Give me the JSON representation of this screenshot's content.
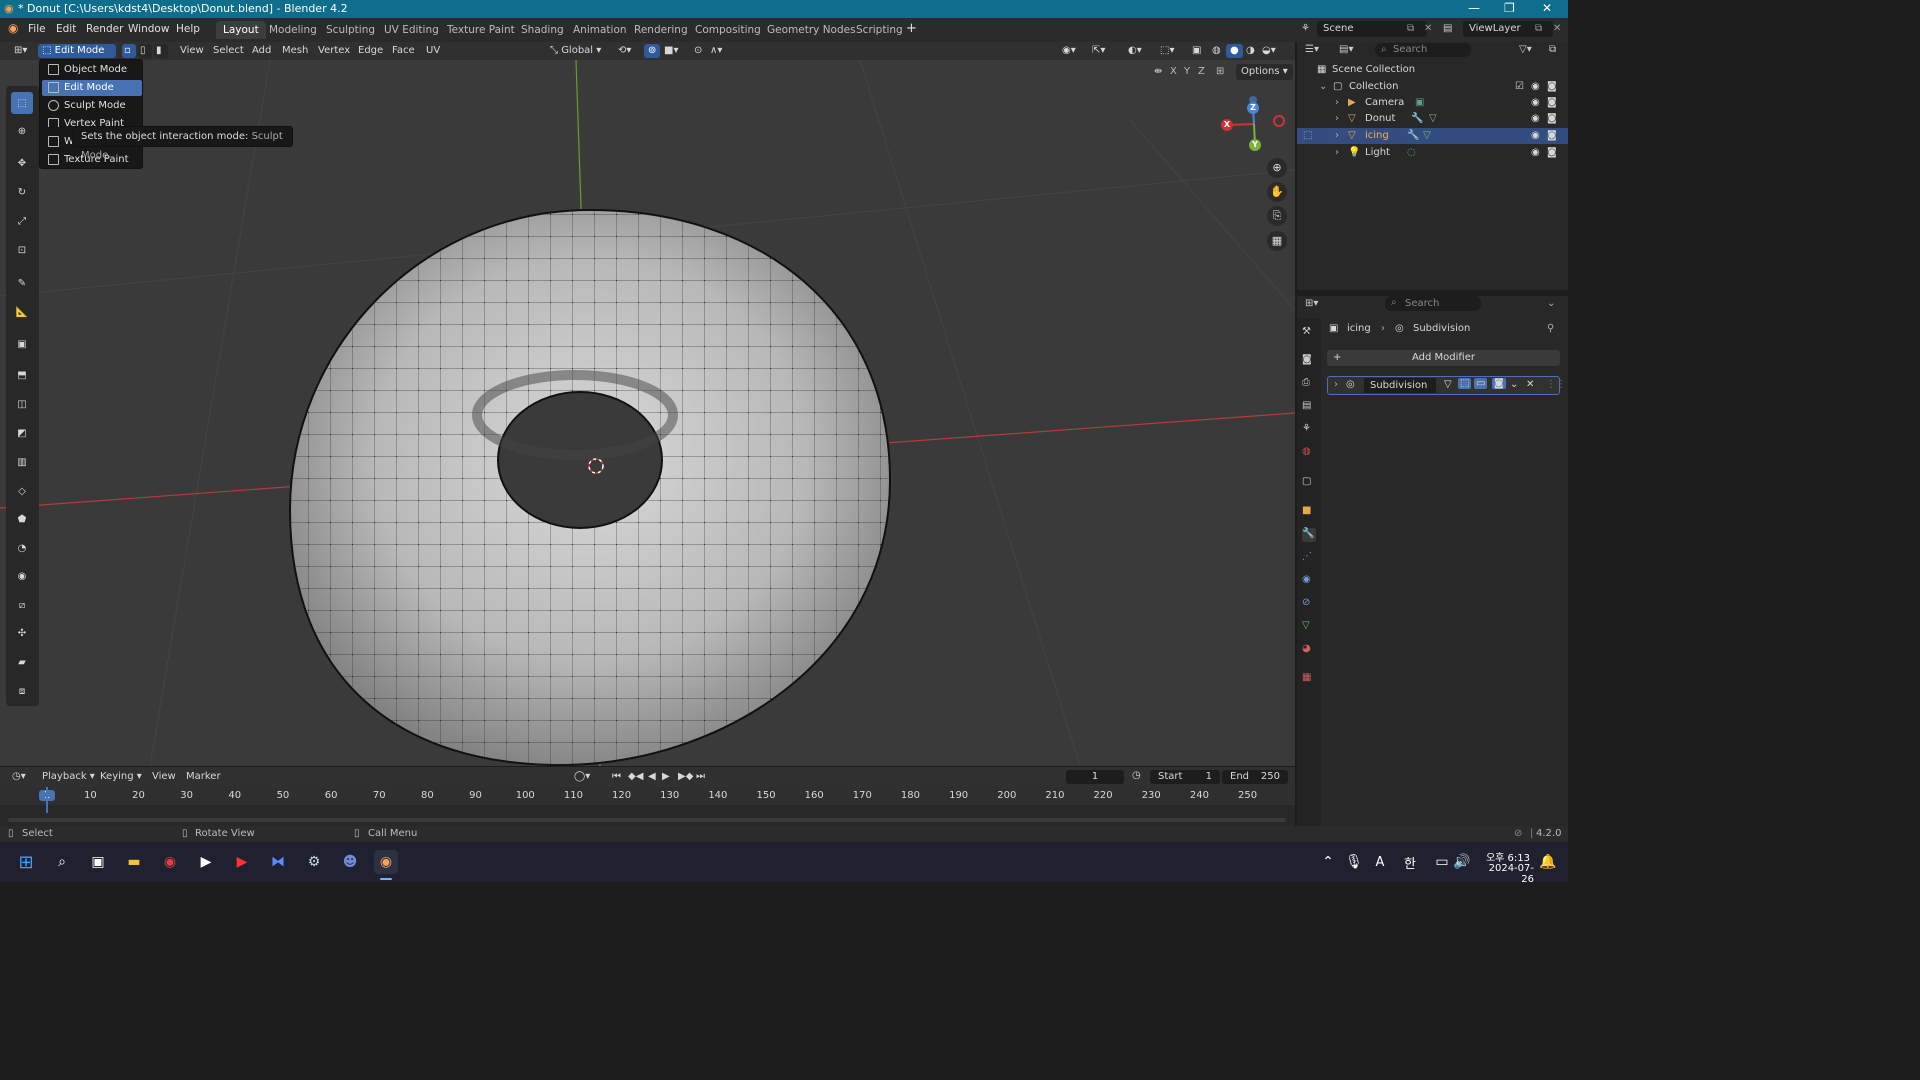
{
  "window": {
    "title": "* Donut [C:\\Users\\kdst4\\Desktop\\Donut.blend] - Blender 4.2"
  },
  "topmenu": [
    "File",
    "Edit",
    "Render",
    "Window",
    "Help"
  ],
  "workspaces": [
    "Layout",
    "Modeling",
    "Sculpting",
    "UV Editing",
    "Texture Paint",
    "Shading",
    "Animation",
    "Rendering",
    "Compositing",
    "Geometry Nodes",
    "Scripting"
  ],
  "scene": {
    "scene_label": "Scene",
    "viewlayer_label": "ViewLayer"
  },
  "viewport_header": {
    "mode": "Edit Mode",
    "menus": [
      "View",
      "Select",
      "Add",
      "Mesh",
      "Vertex",
      "Edge",
      "Face",
      "UV"
    ],
    "orientation": "Global",
    "options": "Options",
    "axes": [
      "X",
      "Y",
      "Z"
    ]
  },
  "mode_menu": {
    "items": [
      "Object Mode",
      "Edit Mode",
      "Sculpt Mode",
      "Vertex Paint",
      "Weight Paint",
      "Texture Paint"
    ],
    "selected": "Edit Mode"
  },
  "tooltip": {
    "text": "Sets the object interaction mode:",
    "value": "Sculpt Mode"
  },
  "gizmo": {
    "x": "X",
    "y": "Y",
    "z": "Z"
  },
  "outliner": {
    "search_placeholder": "Search",
    "scene_collection": "Scene Collection",
    "collection": "Collection",
    "objects": [
      {
        "name": "Camera",
        "selected": false
      },
      {
        "name": "Donut",
        "selected": false
      },
      {
        "name": "icing",
        "selected": true
      },
      {
        "name": "Light",
        "selected": false
      }
    ]
  },
  "properties": {
    "search_placeholder": "Search",
    "breadcrumb_object": "icing",
    "breadcrumb_modifier": "Subdivision",
    "add_modifier": "Add Modifier",
    "modifier_name": "Subdivision"
  },
  "timeline": {
    "menus": [
      "Playback",
      "Keying",
      "View",
      "Marker"
    ],
    "current_frame": "1",
    "start_label": "Start",
    "start_value": "1",
    "end_label": "End",
    "end_value": "250",
    "ticks": [
      "1",
      "10",
      "20",
      "30",
      "40",
      "50",
      "60",
      "70",
      "80",
      "90",
      "100",
      "110",
      "120",
      "130",
      "140",
      "150",
      "160",
      "170",
      "180",
      "190",
      "200",
      "210",
      "220",
      "230",
      "240",
      "250"
    ]
  },
  "statusbar": {
    "select": "Select",
    "rotate": "Rotate View",
    "call_menu": "Call Menu",
    "version": "4.2.0"
  },
  "taskbar": {
    "time": "오후 6:13",
    "date": "2024-07-26",
    "ime": "A",
    "ime2": "한"
  }
}
